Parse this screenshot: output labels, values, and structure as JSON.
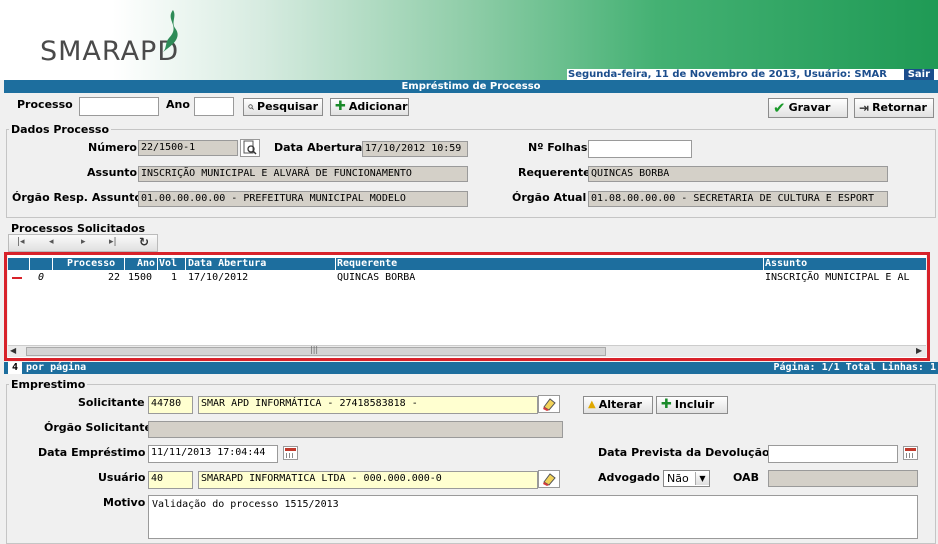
{
  "brand": {
    "logo_text": "SMARAPD"
  },
  "header": {
    "date_user": "Segunda-feira, 11 de Novembro de 2013, Usuário: SMAR",
    "sair": "Sair"
  },
  "title": "Empréstimo de Processo",
  "search": {
    "processo_label": "Processo",
    "processo_value": "",
    "ano_label": "Ano",
    "ano_value": "",
    "pesquisar": "Pesquisar",
    "adicionar": "Adicionar",
    "gravar": "Gravar",
    "retornar": "Retornar"
  },
  "dados": {
    "legend": "Dados Processo",
    "numero_label": "Número",
    "numero": "22/1500-1",
    "data_abertura_label": "Data Abertura",
    "data_abertura": "17/10/2012 10:59",
    "folhas_label": "Nº Folhas",
    "folhas": "",
    "assunto_label": "Assunto",
    "assunto": "INSCRIÇÃO MUNICIPAL E ALVARÁ DE FUNCIONAMENTO",
    "requerente_label": "Requerente",
    "requerente": "QUINCAS BORBA",
    "orgao_resp_label": "Órgão Resp. Assunto",
    "orgao_resp": "01.00.00.00.00 - PREFEITURA MUNICIPAL MODELO",
    "orgao_atual_label": "Órgão Atual",
    "orgao_atual": "01.08.00.00.00 - SECRETARIA DE CULTURA E ESPORT"
  },
  "solicitados": {
    "legend": "Processos Solicitados",
    "columns": {
      "processo": "Processo",
      "ano": "Ano",
      "vol": "Vol",
      "data": "Data Abertura",
      "requerente": "Requerente",
      "assunto": "Assunto"
    },
    "rows": [
      {
        "flag": "0",
        "processo": "22",
        "ano": "1500",
        "vol": "1",
        "data": "17/10/2012",
        "requerente": "QUINCAS BORBA",
        "assunto": "INSCRIÇÃO MUNICIPAL E AL"
      }
    ],
    "page_size": "4",
    "per_page_label": "por página",
    "paging": "Página: 1/1 Total Linhas: 1"
  },
  "emprestimo": {
    "legend": "Emprestimo",
    "solicitante_label": "Solicitante",
    "solicitante_code": "44780",
    "solicitante_name": "SMAR APD INFORMÁTICA - 27418583818 -",
    "alterar": "Alterar",
    "incluir": "Incluir",
    "orgao_solicitante_label": "Órgão Solicitante",
    "orgao_solicitante": "",
    "data_emprestimo_label": "Data Empréstimo",
    "data_emprestimo": "11/11/2013 17:04:44",
    "data_prevista_label": "Data Prevista da Devolução",
    "data_prevista": "",
    "usuario_label": "Usuário",
    "usuario_code": "40",
    "usuario_name": "SMARAPD INFORMATICA LTDA - 000.000.000-0",
    "advogado_label": "Advogado",
    "advogado": "Não",
    "oab_label": "OAB",
    "oab": "",
    "motivo_label": "Motivo",
    "motivo": "Validação do processo 1515/2013"
  }
}
